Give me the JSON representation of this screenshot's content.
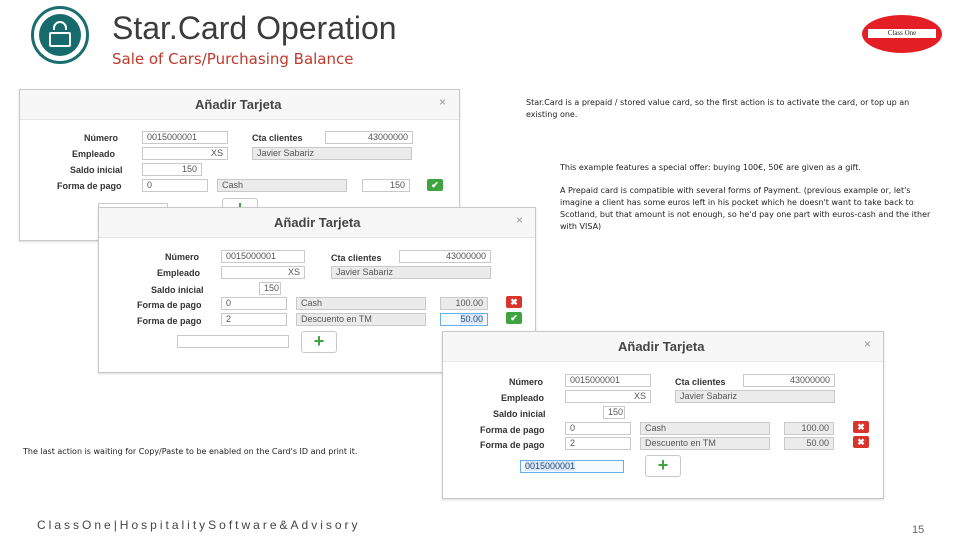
{
  "header": {
    "title": "Star.Card Operation",
    "subtitle": "Sale of Cars/Purchasing Balance",
    "brand_badge": "Class One"
  },
  "notes": {
    "intro": "Star.Card is a prepaid / stored value card, so the first action is to activate the card, or top up an existing one.",
    "offer": "This example features a special offer: buying 100€, 50€ are given as a gift.",
    "payment": "A Prepaid card is compatible with several forms of Payment. (previous example or, let's imagine a client has some euros left in his pocket which he doesn't want to take back to Scotland, but that amount is not enough, so he'd pay one part with euros-cash and the ither with VISA)",
    "last_action": "The last action is waiting for Copy/Paste to be enabled on the Card's ID and print it."
  },
  "dialog": {
    "title": "Añadir Tarjeta",
    "close": "×",
    "labels": {
      "numero": "Número",
      "empleado": "Empleado",
      "saldo": "Saldo inicial",
      "forma": "Forma de pago",
      "cta": "Cta clientes"
    },
    "numero_value": "0015000001",
    "empleado_code": "XS",
    "empleado_name": "Javier Sabariz",
    "saldo_value": "150",
    "cta_value": "43000000",
    "add_symbol": "+",
    "ok_symbol": "✔",
    "del_symbol": "✖"
  },
  "dialog1": {
    "pago1_code": "0",
    "pago1_name": "Cash",
    "pago1_amount": "150"
  },
  "dialog2": {
    "pago1_code": "0",
    "pago1_name": "Cash",
    "pago1_amount": "100.00",
    "pago2_code": "2",
    "pago2_name": "Descuento en TM",
    "pago2_amount": "50.00"
  },
  "dialog3": {
    "pago1_code": "0",
    "pago1_name": "Cash",
    "pago1_amount": "100.00",
    "pago2_code": "2",
    "pago2_name": "Descuento en TM",
    "pago2_amount": "50.00",
    "card_id": "0015000001"
  },
  "footer": {
    "brand": "ClassOne|HospitalitySoftware&Advisory",
    "page_number": "15"
  }
}
